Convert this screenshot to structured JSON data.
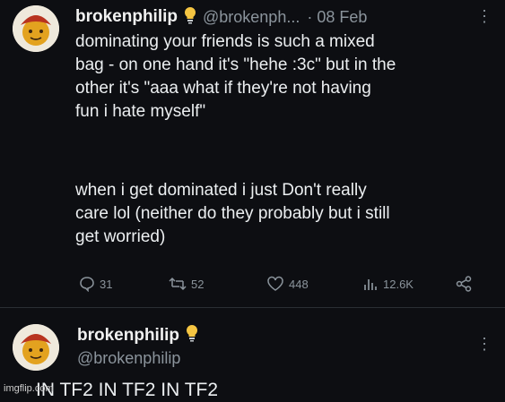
{
  "tweet1": {
    "display_name": "brokenphilip",
    "handle": "@brokenph...",
    "timestamp": "· 08 Feb",
    "lines": [
      "dominating your friends is such a mixed",
      "bag - on one hand it's \"hehe :3c\" but in the",
      "other it's \"aaa what if they're not having",
      "fun i hate myself\""
    ],
    "lines2": [
      "when i get dominated i just Don't really",
      "care lol (neither do they probably but i still",
      "get worried)"
    ],
    "actions": {
      "replies": "31",
      "retweets": "52",
      "likes": "448",
      "views": "12.6K"
    }
  },
  "tweet2": {
    "display_name": "brokenphilip",
    "handle": "@brokenphilip",
    "text_partial": "IN TF2 IN TF2 IN TF2"
  },
  "watermark": "imgflip.com",
  "colors": {
    "background": "#0d0e12",
    "text": "#e7e9ea",
    "muted": "#8b949c",
    "bulb": "#f5c542"
  }
}
